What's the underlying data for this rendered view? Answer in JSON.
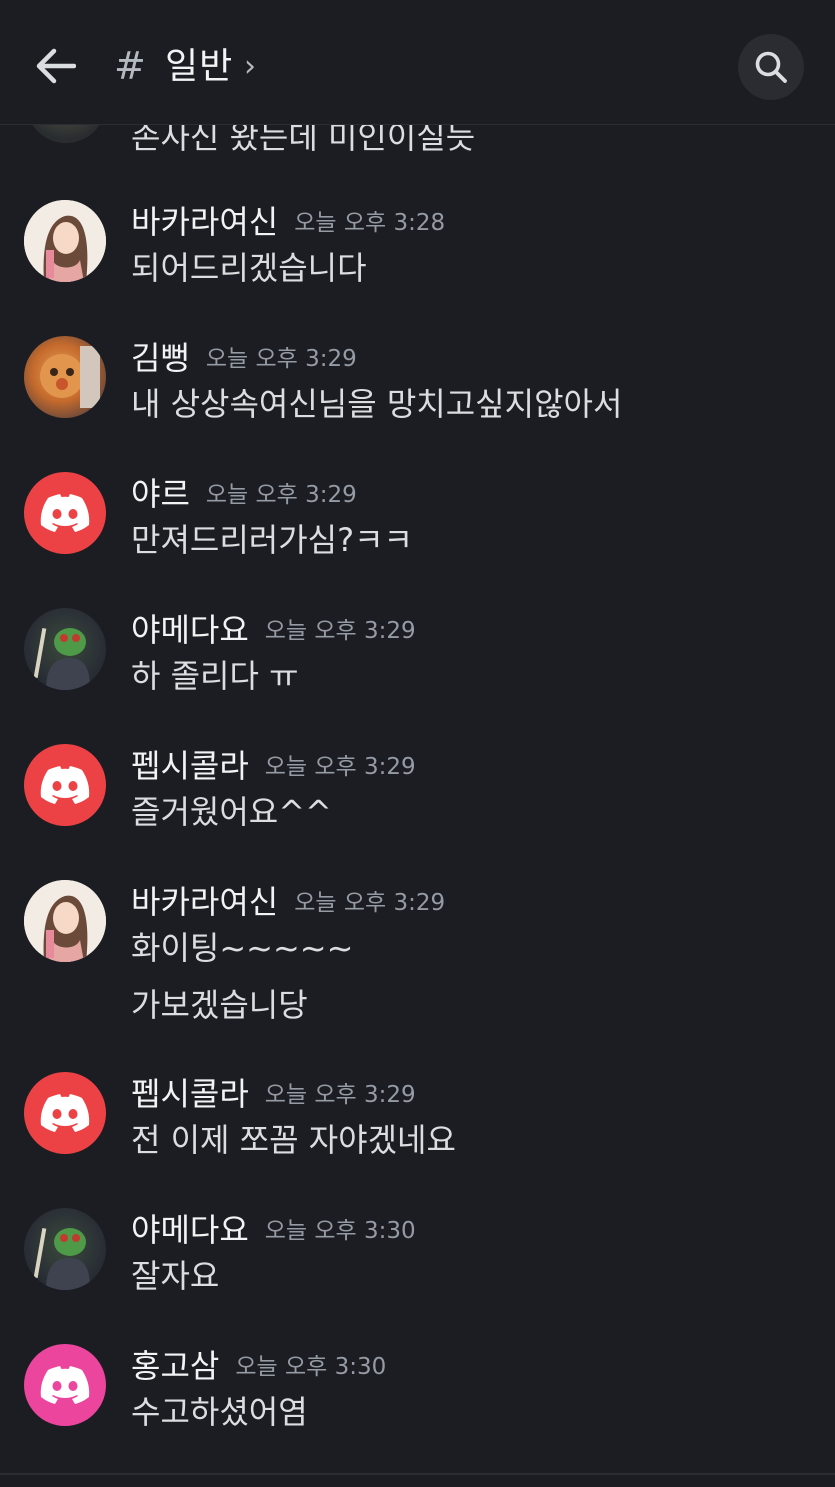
{
  "header": {
    "hash": "#",
    "channel_name": "일반",
    "chevron": "›",
    "back_icon": "arrow-left-icon",
    "search_icon": "search-icon"
  },
  "partial_message": {
    "text": "손사신 왔는데 미인이실듯"
  },
  "messages": [
    {
      "username": "바카라여신",
      "timestamp": "오늘 오후 3:28",
      "lines": [
        "되어드리겠습니다"
      ],
      "avatar": "photo-girl"
    },
    {
      "username": "김뻥",
      "timestamp": "오늘 오후 3:29",
      "lines": [
        "내 상상속여신님을 망치고싶지않아서"
      ],
      "avatar": "photo-bread"
    },
    {
      "username": "야르",
      "timestamp": "오늘 오후 3:29",
      "lines": [
        "만져드리러가심?ㅋㅋ"
      ],
      "avatar": "discord-red"
    },
    {
      "username": "야메다요",
      "timestamp": "오늘 오후 3:29",
      "lines": [
        "하 졸리다 ㅠ"
      ],
      "avatar": "photo-pepe"
    },
    {
      "username": "펩시콜라",
      "timestamp": "오늘 오후 3:29",
      "lines": [
        "즐거웠어요^^"
      ],
      "avatar": "discord-red"
    },
    {
      "username": "바카라여신",
      "timestamp": "오늘 오후 3:29",
      "lines": [
        "화이팅~~~~~",
        "가보겠습니당"
      ],
      "avatar": "photo-girl"
    },
    {
      "username": "펩시콜라",
      "timestamp": "오늘 오후 3:29",
      "lines": [
        "전 이제 쪼꼼 자야겠네요"
      ],
      "avatar": "discord-red"
    },
    {
      "username": "야메다요",
      "timestamp": "오늘 오후 3:30",
      "lines": [
        "잘자요"
      ],
      "avatar": "photo-pepe"
    },
    {
      "username": "홍고삼",
      "timestamp": "오늘 오후 3:30",
      "lines": [
        "수고하셨어염"
      ],
      "avatar": "discord-pink"
    }
  ],
  "colors": {
    "background": "#1c1d22",
    "discord_red": "#ed4245",
    "discord_pink": "#eb459e",
    "timestamp": "#949ba4",
    "text": "#dbdee1"
  }
}
